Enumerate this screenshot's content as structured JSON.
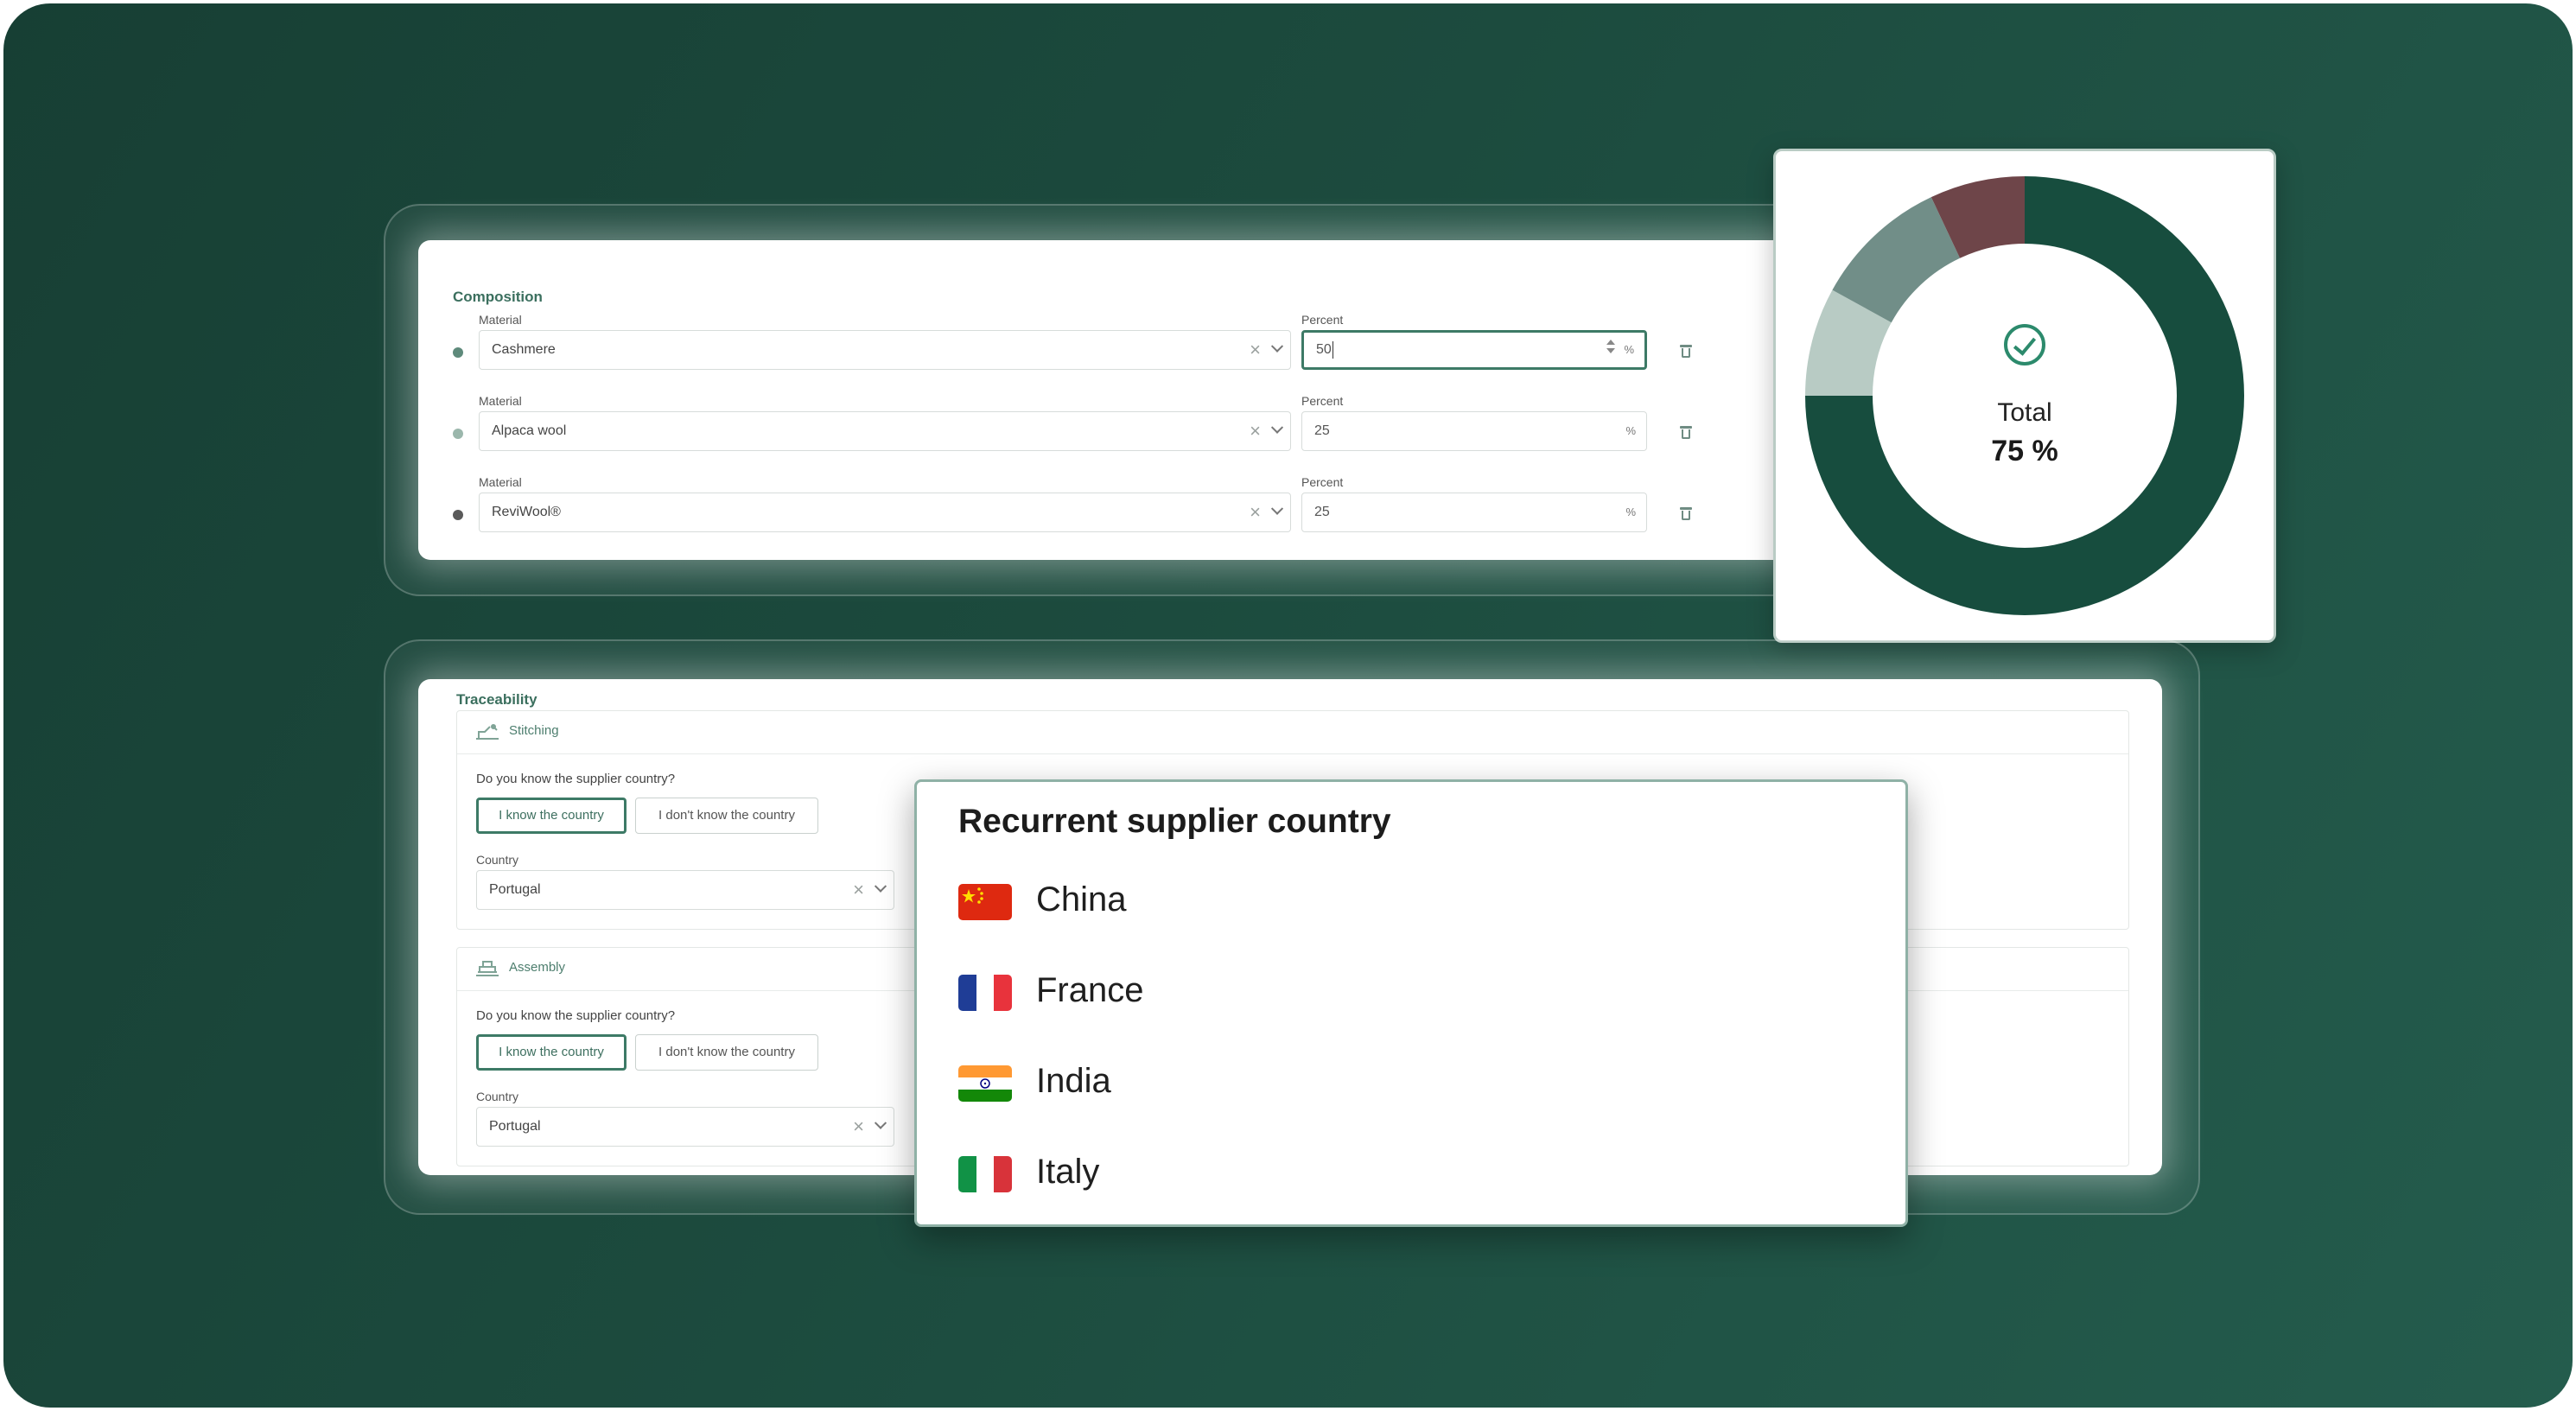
{
  "composition": {
    "title": "Composition",
    "rows": [
      {
        "material_label": "Material",
        "material": "Cashmere",
        "percent_label": "Percent",
        "percent": "50",
        "unit": "%",
        "dot_color": "#5e8a7b"
      },
      {
        "material_label": "Material",
        "material": "Alpaca wool",
        "percent_label": "Percent",
        "percent": "25",
        "unit": "%",
        "dot_color": "#9bb7ac"
      },
      {
        "material_label": "Material",
        "material": "ReviWool®",
        "percent_label": "Percent",
        "percent": "25",
        "unit": "%",
        "dot_color": "#5a5a5a"
      }
    ]
  },
  "total": {
    "label": "Total",
    "value": "75 %",
    "segments": [
      {
        "value": 75,
        "color": "#174d3e"
      },
      {
        "value": 8,
        "color": "#b8cbc4"
      },
      {
        "value": 10,
        "color": "#718e88"
      },
      {
        "value": 7,
        "color": "#6e4549"
      }
    ]
  },
  "traceability": {
    "title": "Traceability",
    "steps": [
      {
        "name": "Stitching",
        "question": "Do you know the supplier country?",
        "know": "I know the country",
        "dont_know": "I don't know the country",
        "country_label": "Country",
        "country": "Portugal"
      },
      {
        "name": "Assembly",
        "question": "Do you know the supplier country?",
        "know": "I know the country",
        "dont_know": "I don't know the country",
        "country_label": "Country",
        "country": "Portugal"
      }
    ]
  },
  "popup": {
    "title": "Recurrent supplier country",
    "countries": [
      "China",
      "France",
      "India",
      "Italy"
    ]
  },
  "colors": {
    "accent": "#3d7a66",
    "background": "#1c4b3e"
  }
}
